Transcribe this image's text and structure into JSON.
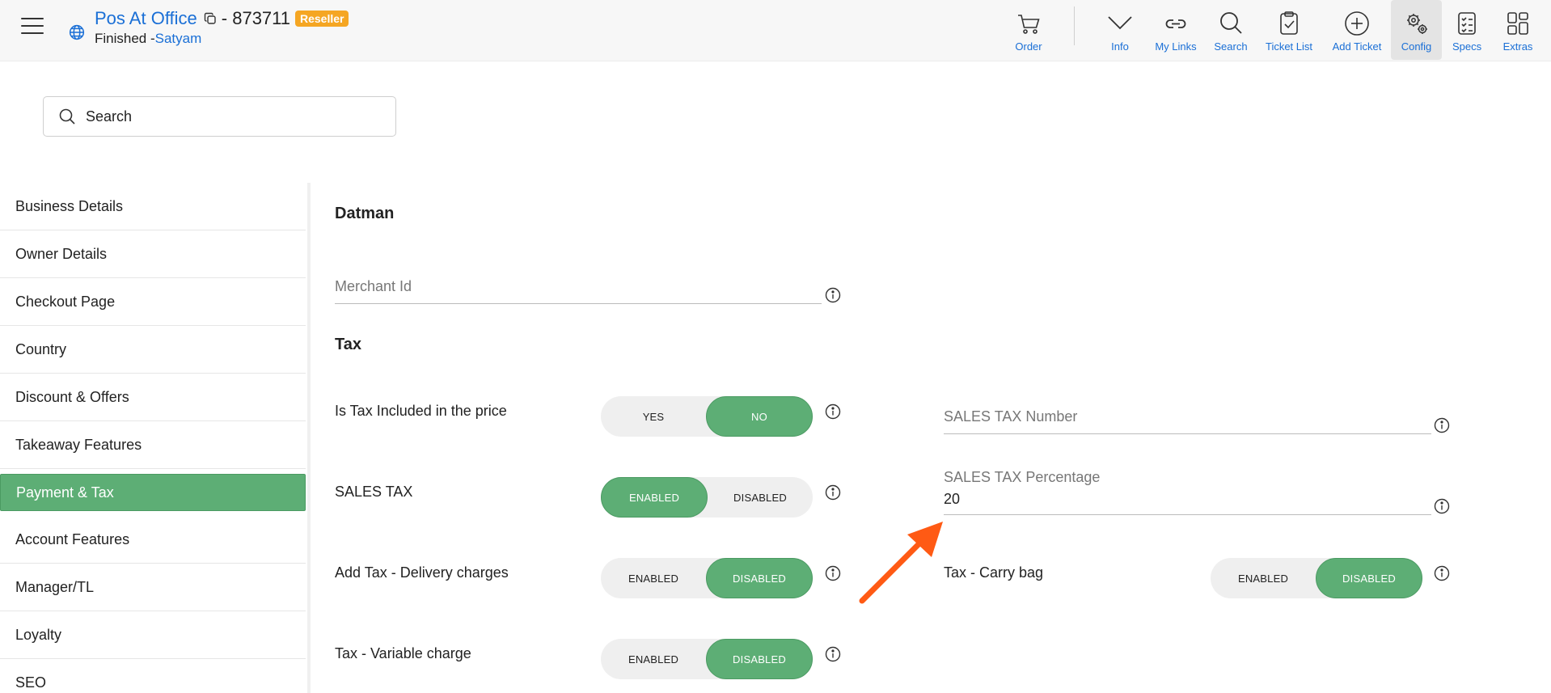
{
  "header": {
    "brand_name": "Pos At Office",
    "brand_id": " - 873711",
    "badge": "Reseller",
    "status_prefix": "Finished -",
    "status_user": "Satyam",
    "nav": {
      "order": "Order",
      "info": "Info",
      "my_links": "My Links",
      "search": "Search",
      "ticket_list": "Ticket List",
      "add_ticket": "Add Ticket",
      "config": "Config",
      "specs": "Specs",
      "extras": "Extras"
    }
  },
  "search": {
    "placeholder": "Search"
  },
  "sidebar": {
    "items": [
      {
        "label": "Business Details"
      },
      {
        "label": "Owner Details"
      },
      {
        "label": "Checkout Page"
      },
      {
        "label": "Country"
      },
      {
        "label": "Discount & Offers"
      },
      {
        "label": "Takeaway Features"
      },
      {
        "label": "Payment & Tax"
      },
      {
        "label": "Account Features"
      },
      {
        "label": "Manager/TL"
      },
      {
        "label": "Loyalty"
      },
      {
        "label": "SEO"
      }
    ]
  },
  "main": {
    "datman_title": "Datman",
    "merchant_id_placeholder": "Merchant Id",
    "tax_title": "Tax",
    "tax_included": {
      "label": "Is Tax Included in the price",
      "opt1": "YES",
      "opt2": "NO",
      "selected": "NO"
    },
    "sales_tax": {
      "label": "SALES TAX",
      "opt1": "ENABLED",
      "opt2": "DISABLED",
      "selected": "ENABLED"
    },
    "delivery_tax": {
      "label": "Add Tax - Delivery charges",
      "opt1": "ENABLED",
      "opt2": "DISABLED",
      "selected": "DISABLED"
    },
    "variable_tax": {
      "label": "Tax - Variable charge",
      "opt1": "ENABLED",
      "opt2": "DISABLED",
      "selected": "DISABLED"
    },
    "carry_bag_tax": {
      "label": "Tax - Carry bag",
      "opt1": "ENABLED",
      "opt2": "DISABLED",
      "selected": "DISABLED"
    },
    "sales_tax_number_placeholder": "SALES TAX Number",
    "sales_tax_percentage": {
      "label": "SALES TAX Percentage",
      "value": "20"
    }
  },
  "colors": {
    "accent_green": "#5dae75",
    "link_blue": "#1a6fd6",
    "badge_orange": "#f5a623",
    "arrow_orange": "#ff5a14"
  }
}
